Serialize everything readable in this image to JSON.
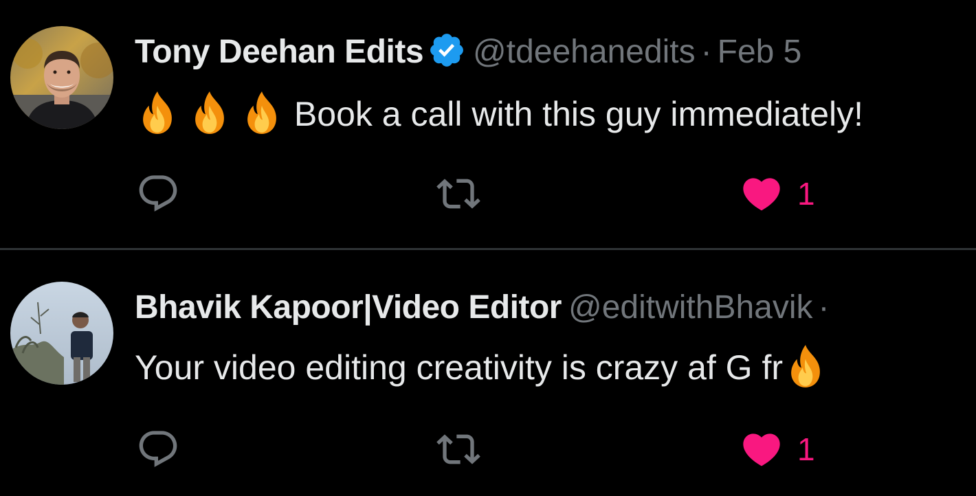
{
  "colors": {
    "background": "#000000",
    "text_primary": "#e7e9ea",
    "text_secondary": "#71767b",
    "divider": "#2f3336",
    "verified_badge": "#1d9bf0",
    "like_active": "#f91880"
  },
  "tweets": [
    {
      "display_name": "Tony Deehan Edits",
      "verified": true,
      "handle": "@tdeehanedits",
      "separator": "·",
      "date": "Feb 5",
      "leading_emojis": [
        "fire-emoji",
        "fire-emoji",
        "fire-emoji"
      ],
      "text": "Book a call with this guy immediately!",
      "actions": {
        "reply_icon": "reply-icon",
        "retweet_icon": "retweet-icon",
        "like_icon": "heart-filled-icon",
        "like_count": "1",
        "liked": true
      }
    },
    {
      "display_name": "Bhavik Kapoor|Video Editor",
      "verified": false,
      "handle": "@editwithBhavik",
      "separator": "·",
      "text": "Your video editing creativity is crazy af G fr",
      "trailing_emojis": [
        "fire-emoji"
      ],
      "actions": {
        "reply_icon": "reply-icon",
        "retweet_icon": "retweet-icon",
        "like_icon": "heart-filled-icon",
        "like_count": "1",
        "liked": true
      }
    }
  ]
}
